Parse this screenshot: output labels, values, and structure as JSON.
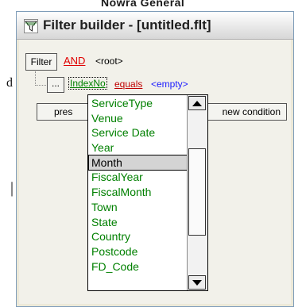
{
  "background": {
    "partial_window_text": "Nowra General",
    "fragment_left": "d",
    "fragment_mark": "|"
  },
  "window": {
    "title": "Filter builder - [untitled.flt]",
    "icon": "filter-funnel-icon"
  },
  "filter": {
    "button_label": "Filter",
    "logic": "AND",
    "root": "<root>"
  },
  "condition": {
    "ellipsis": "...",
    "field": "IndexNo",
    "operator": "equals",
    "value": "<empty>"
  },
  "buttons": {
    "press_partial": "pres",
    "new_condition_partial": "new condition"
  },
  "dropdown": {
    "selected": "Month",
    "items": [
      "ServiceType",
      "Venue",
      "Service Date",
      "Year",
      "Month",
      "FiscalYear",
      "FiscalMonth",
      "Town",
      "State",
      "Country",
      "Postcode",
      "FD_Code"
    ]
  },
  "colors": {
    "field_green": "#008000",
    "logic_red": "#e00000",
    "value_blue": "#1a1aff"
  }
}
